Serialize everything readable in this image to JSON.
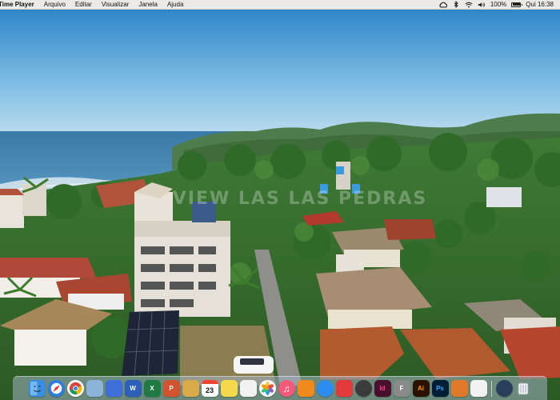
{
  "menubar": {
    "app_name": "Time Player",
    "menus": [
      "Arquivo",
      "Editar",
      "Visualizar",
      "Janela",
      "Ajuda"
    ],
    "status": {
      "icons": [
        "creative-cloud-icon",
        "bluetooth-icon",
        "wifi-icon",
        "volume-icon"
      ],
      "battery_text": "100%",
      "battery_level": 1.0,
      "datetime": "Qui 16:38"
    }
  },
  "video": {
    "watermark_text": "VIEW LAS LAS PEDRAS"
  },
  "dock": {
    "items": [
      {
        "name": "finder-icon",
        "label": "",
        "bg": "#3a8de0"
      },
      {
        "name": "safari-icon",
        "label": "",
        "bg": "#2b7de0"
      },
      {
        "name": "chrome-icon",
        "label": "",
        "bg": "#ffffff"
      },
      {
        "name": "preview-icon",
        "label": "",
        "bg": "#8bb4d8"
      },
      {
        "name": "keynote-stand-icon",
        "label": "",
        "bg": "#3d6fd8"
      },
      {
        "name": "word-icon",
        "label": "W",
        "bg": "#2b5fb8"
      },
      {
        "name": "excel-icon",
        "label": "X",
        "bg": "#1f7a44"
      },
      {
        "name": "powerpoint-icon",
        "label": "P",
        "bg": "#d2542c"
      },
      {
        "name": "notes-folder-icon",
        "label": "",
        "bg": "#d9a94a"
      },
      {
        "name": "calendar-icon",
        "label": "23",
        "bg": "#ffffff"
      },
      {
        "name": "stickies-icon",
        "label": "",
        "bg": "#f4d94a"
      },
      {
        "name": "reminders-icon",
        "label": "",
        "bg": "#f2f2f2"
      },
      {
        "name": "photos-icon",
        "label": "",
        "bg": "#ffffff"
      },
      {
        "name": "music-icon",
        "label": "",
        "bg": "#f55a7a"
      },
      {
        "name": "books-icon",
        "label": "",
        "bg": "#f08a1c"
      },
      {
        "name": "app-store-icon",
        "label": "",
        "bg": "#2d8cf0"
      },
      {
        "name": "vpn-icon",
        "label": "",
        "bg": "#e23a3a"
      },
      {
        "name": "openai-icon",
        "label": "",
        "bg": "#3b3b3b"
      },
      {
        "name": "indesign-icon",
        "label": "Id",
        "bg": "#4a0f2c"
      },
      {
        "name": "font-book-icon",
        "label": "F",
        "bg": "#8a8a8a"
      },
      {
        "name": "illustrator-icon",
        "label": "Ai",
        "bg": "#2b1200"
      },
      {
        "name": "photoshop-icon",
        "label": "Ps",
        "bg": "#001e36"
      },
      {
        "name": "slides-icon",
        "label": "",
        "bg": "#e07a2a"
      },
      {
        "name": "document-icon",
        "label": "",
        "bg": "#f2f2f2"
      },
      {
        "name": "quicktime-icon",
        "label": "",
        "bg": "#2a3f5c"
      },
      {
        "name": "trash-icon",
        "label": "",
        "bg": "#d8dde2"
      }
    ]
  }
}
